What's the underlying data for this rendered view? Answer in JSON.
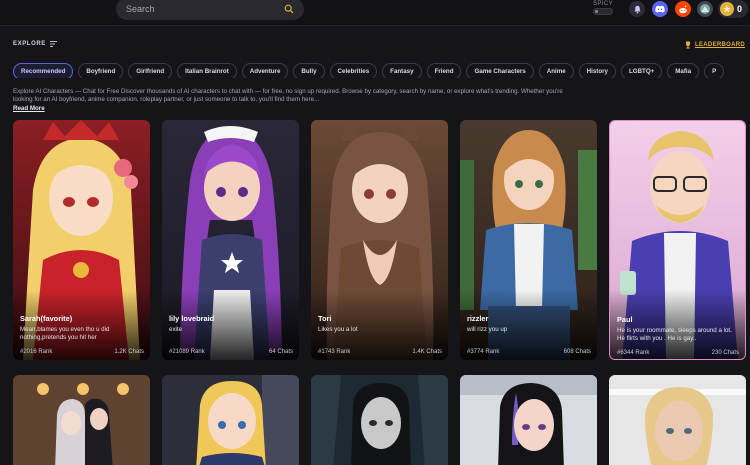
{
  "header": {
    "search_placeholder": "Search",
    "spicy_label": "SPICY",
    "coin_count": "0"
  },
  "explore": {
    "label": "EXPLORE",
    "leaderboard_label": "LEADERBOARD"
  },
  "categories": [
    "Recommended",
    "Boyfriend",
    "Girlfriend",
    "Italian Brainrot",
    "Adventure",
    "Bully",
    "Celebrities",
    "Fantasy",
    "Friend",
    "Game Characters",
    "Anime",
    "History",
    "LGBTQ+",
    "Mafia",
    "P"
  ],
  "description": {
    "text": "Explore AI Characters — Chat for Free Discover thousands of AI characters to chat with — for free, no sign up required. Browse by category, search by name, or explore what's trending. Whether you're looking for an AI boyfriend, anime companion, roleplay partner, or just someone to talk to, you'll find them here...",
    "read_more": "Read More"
  },
  "cards": [
    {
      "name": "Sarah(favorite)",
      "desc": "Mean,blames you even tho u did nothing,pretends you hit her",
      "rank": "#2016 Rank",
      "chats": "1.2K Chats"
    },
    {
      "name": "lily lovebraid",
      "desc": "exite",
      "rank": "#21089 Rank",
      "chats": "64 Chats"
    },
    {
      "name": "Tori",
      "desc": "Likes you a lot",
      "rank": "#1743 Rank",
      "chats": "1.4K Chats"
    },
    {
      "name": "rizzler",
      "desc": "will rizz you up",
      "rank": "#3774 Rank",
      "chats": "608 Chats"
    },
    {
      "name": "Paul",
      "desc": "He is your roommate, sleeps around a lot. He flirts with you . He is gay..",
      "rank": "#6344 Rank",
      "chats": "230 Chats"
    }
  ],
  "colors": {
    "background": "#151419",
    "accent": "#5a66d8",
    "leaderboard": "#e0b23a",
    "discord": "#5865f2",
    "reddit": "#ff4500"
  },
  "icons": [
    "search-icon",
    "sort-icon",
    "trophy-icon",
    "notification-icon",
    "discord-icon",
    "reddit-icon",
    "community-icon",
    "coin-icon"
  ]
}
